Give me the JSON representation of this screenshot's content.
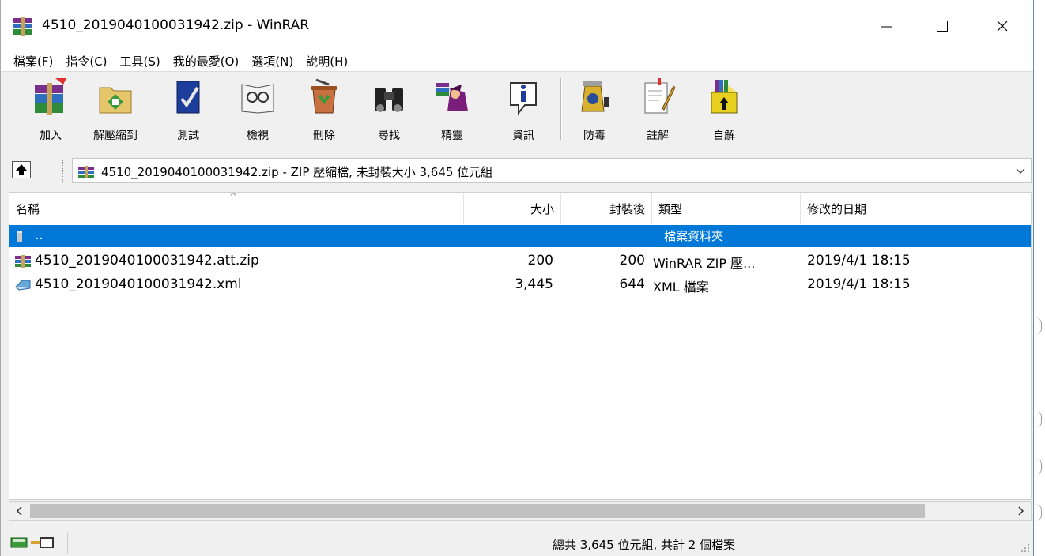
{
  "window": {
    "title": "4510_2019040100031942.zip - WinRAR",
    "icon": "winrar-books-icon"
  },
  "menu": [
    "檔案(F)",
    "指令(C)",
    "工具(S)",
    "我的最愛(O)",
    "選項(N)",
    "說明(H)"
  ],
  "toolbar": {
    "buttons": [
      {
        "label": "加入",
        "icon": "add-archive-icon"
      },
      {
        "label": "解壓縮到",
        "icon": "extract-to-icon"
      },
      {
        "label": "測試",
        "icon": "test-icon"
      },
      {
        "label": "檢視",
        "icon": "view-icon"
      },
      {
        "label": "刪除",
        "icon": "delete-icon"
      },
      {
        "label": "尋找",
        "icon": "find-icon"
      },
      {
        "label": "精靈",
        "icon": "wizard-icon"
      },
      {
        "label": "資訊",
        "icon": "info-icon"
      },
      {
        "label": "防毒",
        "icon": "virus-scan-icon"
      },
      {
        "label": "註解",
        "icon": "comment-icon"
      },
      {
        "label": "自解",
        "icon": "sfx-icon"
      }
    ]
  },
  "address": {
    "text": "4510_2019040100031942.zip - ZIP 壓縮檔, 未封裝大小 3,645 位元組"
  },
  "columns": {
    "name": "名稱",
    "size": "大小",
    "packed": "封裝後",
    "type": "類型",
    "modified": "修改的日期"
  },
  "rows": [
    {
      "name": "..",
      "size": "",
      "packed": "",
      "type": "檔案資料夾",
      "modified": "",
      "icon": "folder-up-icon",
      "selected": true
    },
    {
      "name": "4510_2019040100031942.att.zip",
      "size": "200",
      "packed": "200",
      "type": "WinRAR ZIP 壓...",
      "modified": "2019/4/1 18:15",
      "icon": "zip-archive-icon",
      "selected": false
    },
    {
      "name": "4510_2019040100031942.xml",
      "size": "3,445",
      "packed": "644",
      "type": "XML 檔案",
      "modified": "2019/4/1 18:15",
      "icon": "xml-file-icon",
      "selected": false
    }
  ],
  "status": {
    "text": "總共 3,645 位元組, 共計 2 個檔案"
  },
  "colors": {
    "selection": "#0078d7",
    "scroll_thumb": "#c1c1c1"
  }
}
